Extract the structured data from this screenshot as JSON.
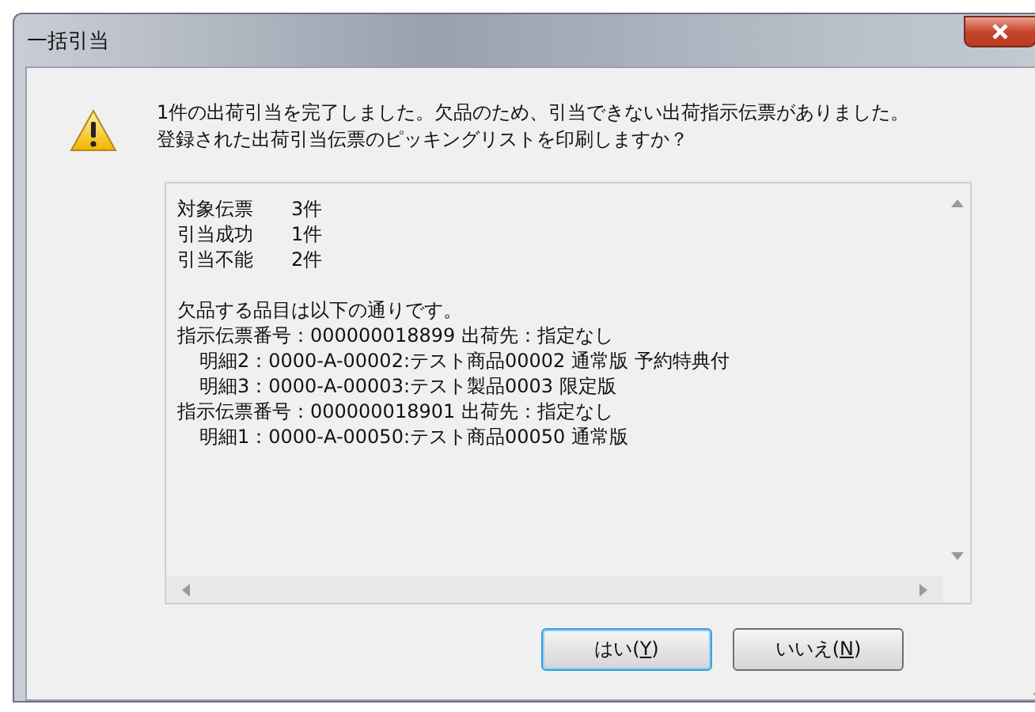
{
  "window": {
    "title": "一括引当"
  },
  "message": [
    "1件の出荷引当を完了しました。欠品のため、引当できない出荷指示伝票がありました。",
    "登録された出荷引当伝票のピッキングリストを印刷しますか？"
  ],
  "details": {
    "summary": [
      {
        "label": "対象伝票",
        "value": "3件"
      },
      {
        "label": "引当成功",
        "value": "1件"
      },
      {
        "label": "引当不能",
        "value": "2件"
      }
    ],
    "note": "欠品する品目は以下の通りです。",
    "orders": [
      {
        "text": "指示伝票番号：000000018899  出荷先：指定なし",
        "children": [
          {
            "text": "明細2：0000-A-00002:テスト商品00002 通常版 予約特典付"
          },
          {
            "text": "明細3：0000-A-00003:テスト製品0003 限定版"
          }
        ]
      },
      {
        "text": "指示伝票番号：000000018901  出荷先：指定なし",
        "children": [
          {
            "text": "明細1：0000-A-00050:テスト商品00050 通常版"
          }
        ]
      }
    ]
  },
  "buttons": [
    {
      "before": "はい(",
      "key": "Y",
      "after": ")",
      "default": true
    },
    {
      "before": "いいえ(",
      "key": "N",
      "after": ")",
      "default": false
    }
  ]
}
